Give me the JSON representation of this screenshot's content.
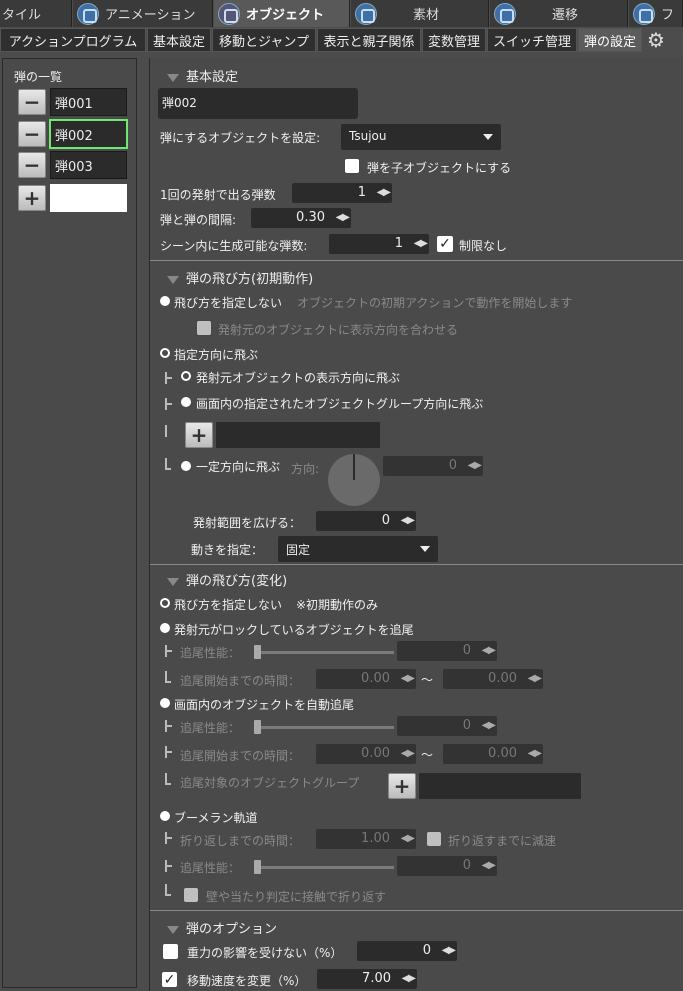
{
  "top_tabs": [
    {
      "label": "タイル"
    },
    {
      "label": "アニメーション"
    },
    {
      "label": "オブジェクト"
    },
    {
      "label": "素材"
    },
    {
      "label": "遷移"
    },
    {
      "label": "フ"
    }
  ],
  "sub_tabs": [
    "アクションプログラム",
    "基本設定",
    "移動とジャンプ",
    "表示と親子関係",
    "変数管理",
    "スイッチ管理",
    "弾の設定"
  ],
  "left": {
    "title": "弾の一覧",
    "items": [
      "弾001",
      "弾002",
      "弾003"
    ],
    "remove_label": "−",
    "add_label": "+"
  },
  "basic": {
    "header": "基本設定",
    "name_value": "弾002",
    "object_label": "弾にするオブジェクトを設定:",
    "object_value": "Tsujou",
    "child_label": "弾を子オブジェクトにする",
    "per_shot_label": "1回の発射で出る弾数",
    "per_shot_value": "1",
    "interval_label": "弾と弾の間隔:",
    "interval_value": "0.30",
    "max_label": "シーン内に生成可能な弾数:",
    "max_value": "1",
    "unlimited_label": "制限なし",
    "arrows": "◀▶"
  },
  "initial": {
    "header": "弾の飛び方(初期動作)",
    "no_dir_label": "飛び方を指定しない",
    "no_dir_desc": "オブジェクトの初期アクションで動作を開始します",
    "match_label": "発射元のオブジェクトに表示方向を合わせる",
    "specified_label": "指定方向に飛ぶ",
    "shooter_dir_label": "発射元オブジェクトの表示方向に飛ぶ",
    "group_dir_label": "画面内の指定されたオブジェクトグループ方向に飛ぶ",
    "fixed_dir_label": "一定方向に飛ぶ",
    "direction_label": "方向:",
    "direction_value": "0",
    "spread_label": "発射範囲を広げる：",
    "spread_value": "0",
    "motion_label": "動きを指定：",
    "motion_value": "固定"
  },
  "change": {
    "header": "弾の飛び方(変化)",
    "no_dir_label": "飛び方を指定しない",
    "no_dir_note": "※初期動作のみ",
    "track_locked_label": "発射元がロックしているオブジェクトを追尾",
    "tracking_perf_label": "追尾性能：",
    "tracking_start_label": "追尾開始までの時間：",
    "tilde": "〜",
    "auto_track_label": "画面内のオブジェクトを自動追尾",
    "target_group_label": "追尾対象のオブジェクトグループ",
    "boomerang_label": "ブーメラン軌道",
    "return_time_label": "折り返しまでの時間：",
    "return_time_value": "1.00",
    "decel_label": "折り返すまでに減速",
    "bounce_label": "壁や当たり判定に接触で折り返す",
    "zero": "0",
    "zero_dec": "0.00"
  },
  "options": {
    "header": "弾のオプション",
    "gravity_label": "重力の影響を受けない（%）",
    "gravity_value": "0",
    "speed_label": "移動速度を変更（%）",
    "speed_value": "7.00"
  }
}
